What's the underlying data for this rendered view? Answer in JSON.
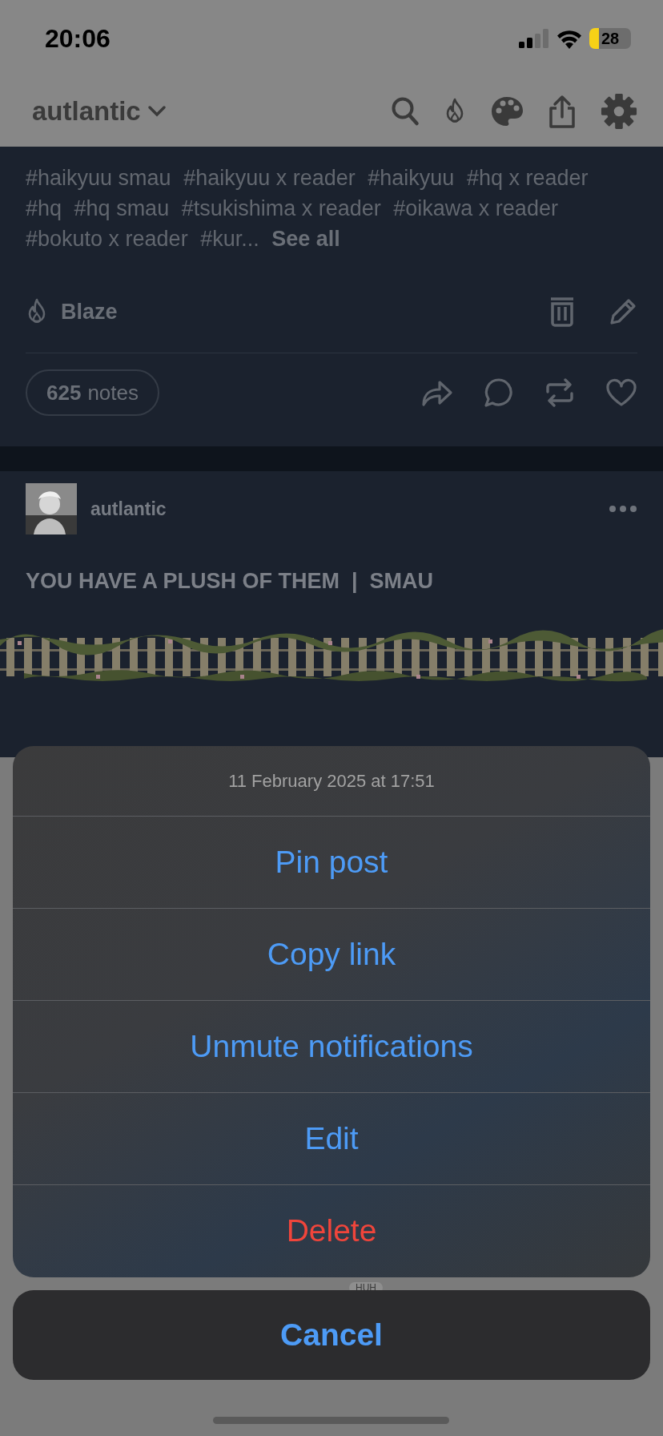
{
  "status_bar": {
    "time": "20:06",
    "battery": "28"
  },
  "header": {
    "blog_name": "autlantic"
  },
  "post_1": {
    "tags": [
      "#haikyuu smau",
      "#haikyuu x reader",
      "#haikyuu",
      "#hq x reader",
      "#hq",
      "#hq smau",
      "#tsukishima x reader",
      "#oikawa x reader",
      "#bokuto x reader",
      "#kur..."
    ],
    "see_all": "See all",
    "blaze": "Blaze",
    "notes_count": "625",
    "notes_label": "notes"
  },
  "post_2": {
    "author": "autlantic",
    "title": "YOU HAVE A PLUSH OF THEM  |  SMAU"
  },
  "background_chip": "HUH",
  "action_sheet": {
    "title": "11 February 2025 at 17:51",
    "actions": [
      {
        "label": "Pin post",
        "kind": "default"
      },
      {
        "label": "Copy link",
        "kind": "default"
      },
      {
        "label": "Unmute notifications",
        "kind": "default"
      },
      {
        "label": "Edit",
        "kind": "default"
      },
      {
        "label": "Delete",
        "kind": "destructive"
      }
    ],
    "cancel": "Cancel"
  }
}
